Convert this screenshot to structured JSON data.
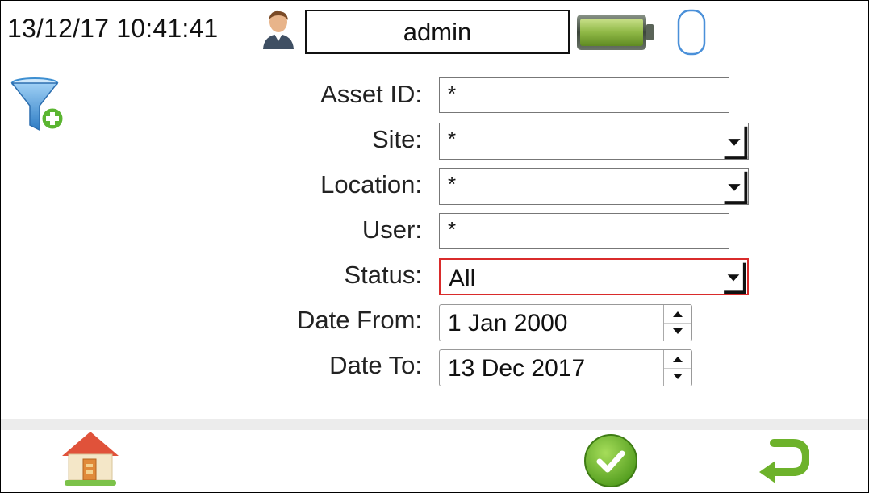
{
  "header": {
    "datetime": "13/12/17 10:41:41",
    "username": "admin",
    "icons": [
      "user-icon",
      "battery-icon",
      "sd-card-icon"
    ]
  },
  "toolbar": {
    "filter_icon": "filter-add-icon"
  },
  "form": {
    "asset_id": {
      "label": "Asset ID:",
      "value": "*"
    },
    "site": {
      "label": "Site:",
      "value": "*"
    },
    "location": {
      "label": "Location:",
      "value": "*"
    },
    "user": {
      "label": "User:",
      "value": "*"
    },
    "status": {
      "label": "Status:",
      "value": "All"
    },
    "date_from": {
      "label": "Date From:",
      "value": "1 Jan 2000"
    },
    "date_to": {
      "label": "Date To:",
      "value": "13 Dec 2017"
    }
  },
  "footer": {
    "icons": [
      "home-icon",
      "confirm-check-icon",
      "return-arrow-icon"
    ]
  },
  "colors": {
    "accent_green": "#6db22b",
    "status_border_red": "#d92b2b",
    "battery_green": "#8fb846",
    "filter_blue": "#3d8fd1"
  }
}
